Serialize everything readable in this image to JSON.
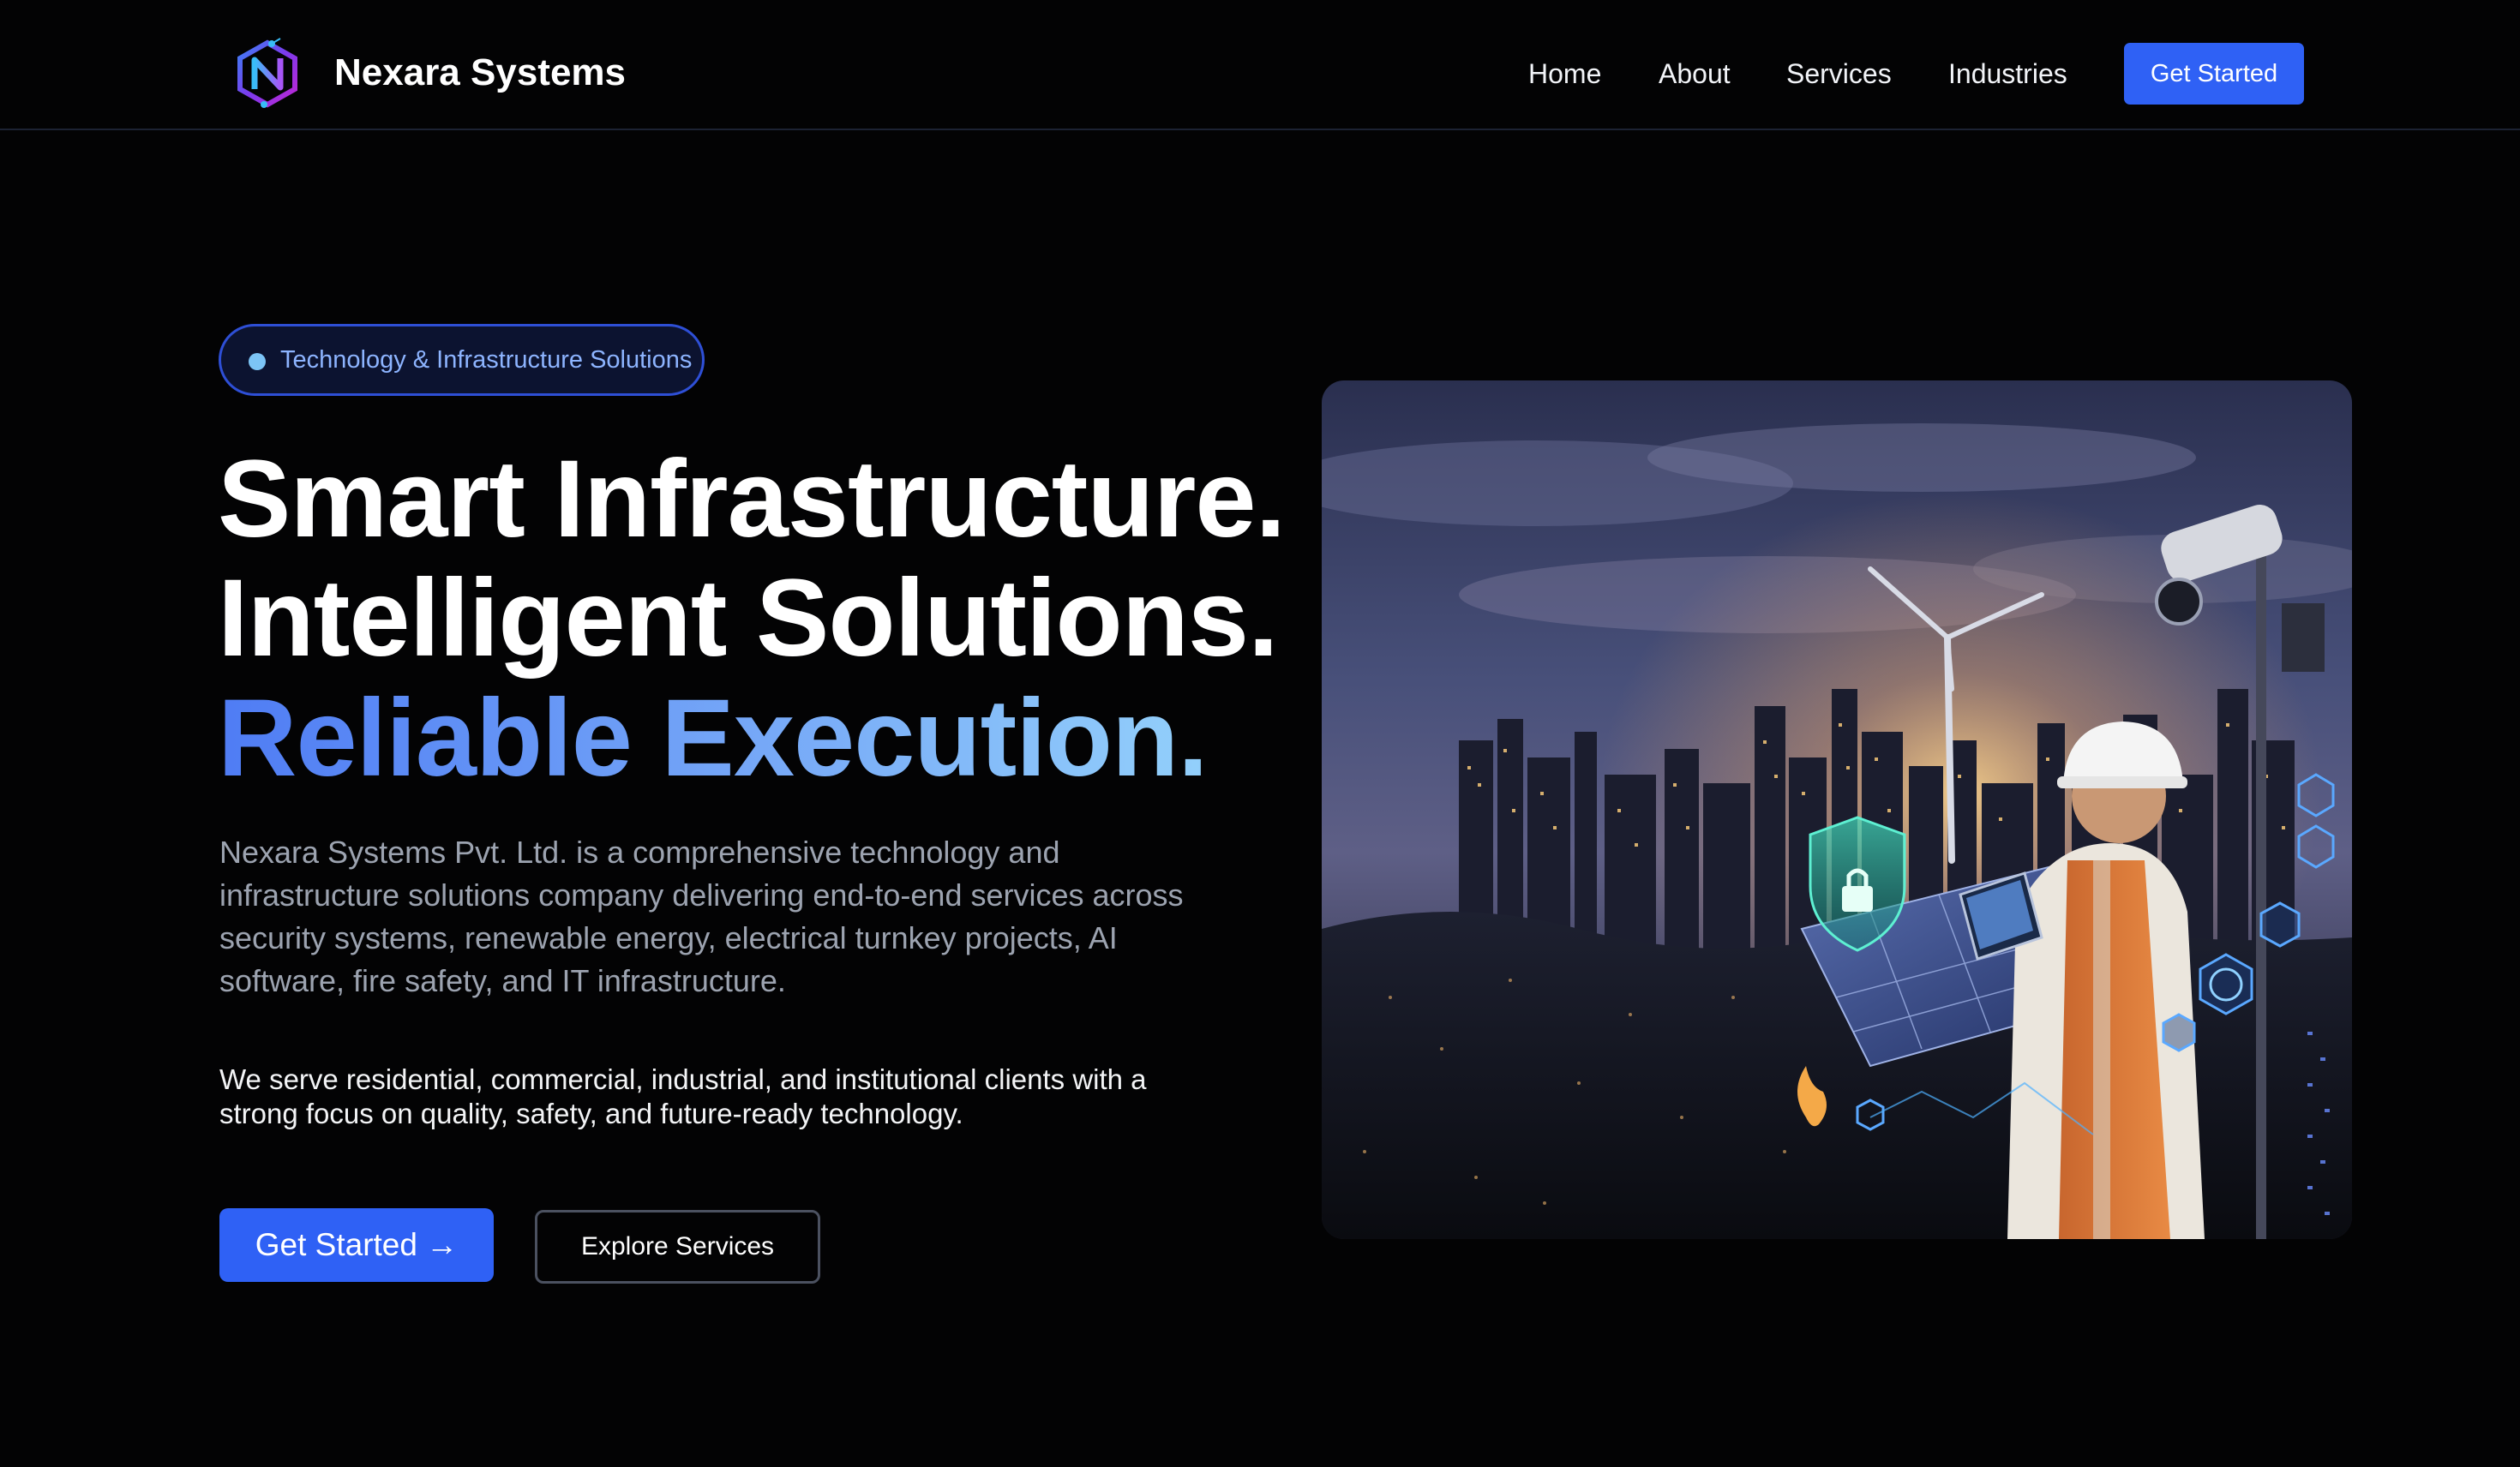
{
  "header": {
    "brand": "Nexara Systems",
    "logo_icon": "hexagon-n-logo-icon",
    "nav": [
      {
        "label": "Home"
      },
      {
        "label": "About"
      },
      {
        "label": "Services"
      },
      {
        "label": "Industries"
      }
    ],
    "cta_label": "Get Started"
  },
  "hero": {
    "badge": "Technology & Infrastructure Solutions",
    "headline_line1": "Smart Infrastructure.",
    "headline_line2": "Intelligent Solutions.",
    "headline_line3": "Reliable Execution.",
    "description": "Nexara Systems Pvt. Ltd. is a comprehensive technology and infrastructure solutions company delivering end-to-end services across security systems, renewable energy, electrical turnkey projects, AI software, fire safety, and IT infrastructure.",
    "description_secondary": "We serve residential, commercial, industrial, and institutional clients with a strong focus on quality, safety, and future-ready technology.",
    "primary_button": "Get Started →",
    "secondary_button": "Explore Services"
  },
  "colors": {
    "background": "#030304",
    "accent": "#2f61f5",
    "badge_text": "#8db4ff",
    "gradient_start": "#4f7cf4",
    "gradient_end": "#93d0fb",
    "muted_text": "#9ca3b0"
  }
}
